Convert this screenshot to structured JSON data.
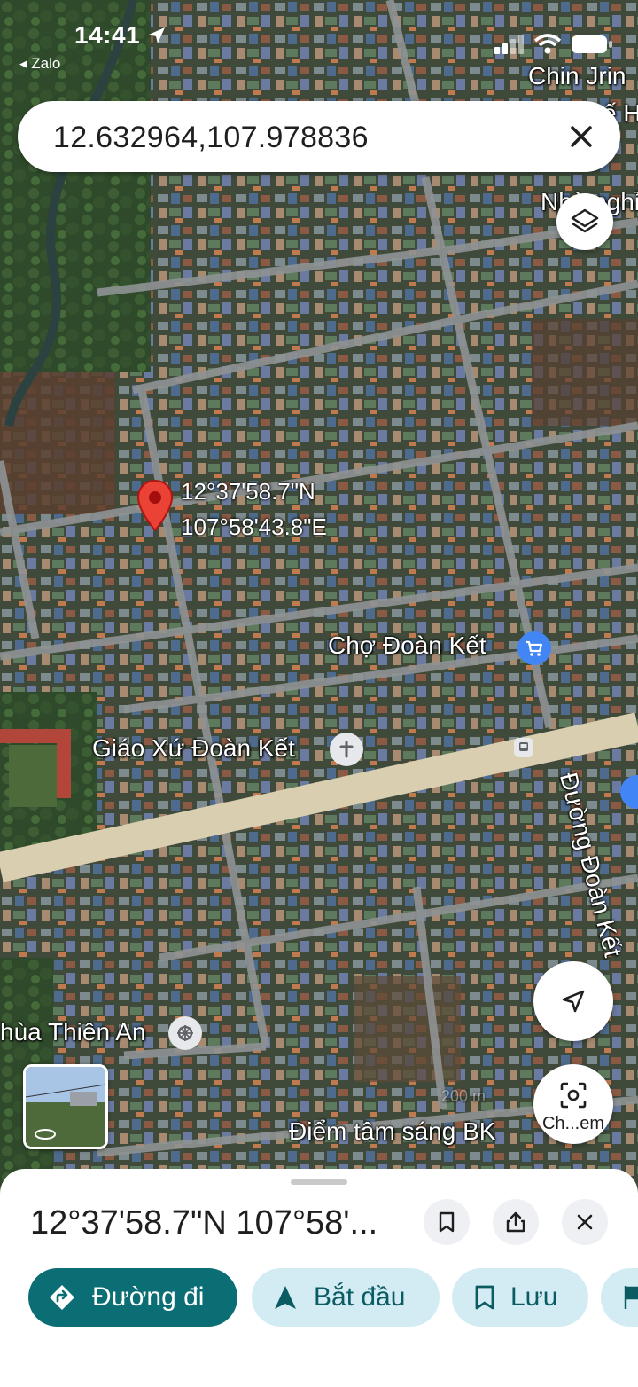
{
  "status_bar": {
    "time": "14:41",
    "back_app": "◂ Zalo"
  },
  "search": {
    "query": "12.632964,107.978836"
  },
  "map": {
    "pin_label_lat": "12°37'58.7\"N",
    "pin_label_lng": "107°58'43.8\"E",
    "labels": {
      "top_right_1": "Chin Jrin",
      "top_right_2": "ế H",
      "top_right_3": "Nhà nghỉ",
      "market": "Chợ Đoàn Kết",
      "church": "Giáo Xứ Đoàn Kết",
      "temple": "hùa Thiên An",
      "street": "Đường Đoàn Kết",
      "spot": "Điểm tâm sáng BK",
      "scale": "200 m"
    }
  },
  "controls": {
    "lens_label": "Ch...em"
  },
  "sheet": {
    "title": "12°37'58.7\"N 107°58'...",
    "chips": {
      "directions": "Đường đi",
      "start": "Bắt đầu",
      "save": "Lưu"
    }
  },
  "colors": {
    "primary_chip": "#0b6e74",
    "secondary_chip": "#d3ecf4",
    "pin": "#ea4335",
    "poi_blue": "#4285f4",
    "poi_gray": "#e6e8ec"
  }
}
